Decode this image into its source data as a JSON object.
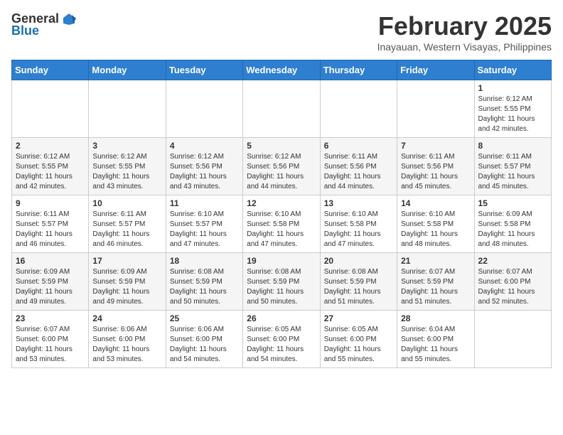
{
  "header": {
    "logo_general": "General",
    "logo_blue": "Blue",
    "month_year": "February 2025",
    "location": "Inayauan, Western Visayas, Philippines"
  },
  "days_of_week": [
    "Sunday",
    "Monday",
    "Tuesday",
    "Wednesday",
    "Thursday",
    "Friday",
    "Saturday"
  ],
  "weeks": [
    [
      {
        "day": "",
        "info": ""
      },
      {
        "day": "",
        "info": ""
      },
      {
        "day": "",
        "info": ""
      },
      {
        "day": "",
        "info": ""
      },
      {
        "day": "",
        "info": ""
      },
      {
        "day": "",
        "info": ""
      },
      {
        "day": "1",
        "info": "Sunrise: 6:12 AM\nSunset: 5:55 PM\nDaylight: 11 hours and 42 minutes."
      }
    ],
    [
      {
        "day": "2",
        "info": "Sunrise: 6:12 AM\nSunset: 5:55 PM\nDaylight: 11 hours and 42 minutes."
      },
      {
        "day": "3",
        "info": "Sunrise: 6:12 AM\nSunset: 5:55 PM\nDaylight: 11 hours and 43 minutes."
      },
      {
        "day": "4",
        "info": "Sunrise: 6:12 AM\nSunset: 5:56 PM\nDaylight: 11 hours and 43 minutes."
      },
      {
        "day": "5",
        "info": "Sunrise: 6:12 AM\nSunset: 5:56 PM\nDaylight: 11 hours and 44 minutes."
      },
      {
        "day": "6",
        "info": "Sunrise: 6:11 AM\nSunset: 5:56 PM\nDaylight: 11 hours and 44 minutes."
      },
      {
        "day": "7",
        "info": "Sunrise: 6:11 AM\nSunset: 5:56 PM\nDaylight: 11 hours and 45 minutes."
      },
      {
        "day": "8",
        "info": "Sunrise: 6:11 AM\nSunset: 5:57 PM\nDaylight: 11 hours and 45 minutes."
      }
    ],
    [
      {
        "day": "9",
        "info": "Sunrise: 6:11 AM\nSunset: 5:57 PM\nDaylight: 11 hours and 46 minutes."
      },
      {
        "day": "10",
        "info": "Sunrise: 6:11 AM\nSunset: 5:57 PM\nDaylight: 11 hours and 46 minutes."
      },
      {
        "day": "11",
        "info": "Sunrise: 6:10 AM\nSunset: 5:57 PM\nDaylight: 11 hours and 47 minutes."
      },
      {
        "day": "12",
        "info": "Sunrise: 6:10 AM\nSunset: 5:58 PM\nDaylight: 11 hours and 47 minutes."
      },
      {
        "day": "13",
        "info": "Sunrise: 6:10 AM\nSunset: 5:58 PM\nDaylight: 11 hours and 47 minutes."
      },
      {
        "day": "14",
        "info": "Sunrise: 6:10 AM\nSunset: 5:58 PM\nDaylight: 11 hours and 48 minutes."
      },
      {
        "day": "15",
        "info": "Sunrise: 6:09 AM\nSunset: 5:58 PM\nDaylight: 11 hours and 48 minutes."
      }
    ],
    [
      {
        "day": "16",
        "info": "Sunrise: 6:09 AM\nSunset: 5:59 PM\nDaylight: 11 hours and 49 minutes."
      },
      {
        "day": "17",
        "info": "Sunrise: 6:09 AM\nSunset: 5:59 PM\nDaylight: 11 hours and 49 minutes."
      },
      {
        "day": "18",
        "info": "Sunrise: 6:08 AM\nSunset: 5:59 PM\nDaylight: 11 hours and 50 minutes."
      },
      {
        "day": "19",
        "info": "Sunrise: 6:08 AM\nSunset: 5:59 PM\nDaylight: 11 hours and 50 minutes."
      },
      {
        "day": "20",
        "info": "Sunrise: 6:08 AM\nSunset: 5:59 PM\nDaylight: 11 hours and 51 minutes."
      },
      {
        "day": "21",
        "info": "Sunrise: 6:07 AM\nSunset: 5:59 PM\nDaylight: 11 hours and 51 minutes."
      },
      {
        "day": "22",
        "info": "Sunrise: 6:07 AM\nSunset: 6:00 PM\nDaylight: 11 hours and 52 minutes."
      }
    ],
    [
      {
        "day": "23",
        "info": "Sunrise: 6:07 AM\nSunset: 6:00 PM\nDaylight: 11 hours and 53 minutes."
      },
      {
        "day": "24",
        "info": "Sunrise: 6:06 AM\nSunset: 6:00 PM\nDaylight: 11 hours and 53 minutes."
      },
      {
        "day": "25",
        "info": "Sunrise: 6:06 AM\nSunset: 6:00 PM\nDaylight: 11 hours and 54 minutes."
      },
      {
        "day": "26",
        "info": "Sunrise: 6:05 AM\nSunset: 6:00 PM\nDaylight: 11 hours and 54 minutes."
      },
      {
        "day": "27",
        "info": "Sunrise: 6:05 AM\nSunset: 6:00 PM\nDaylight: 11 hours and 55 minutes."
      },
      {
        "day": "28",
        "info": "Sunrise: 6:04 AM\nSunset: 6:00 PM\nDaylight: 11 hours and 55 minutes."
      },
      {
        "day": "",
        "info": ""
      }
    ]
  ]
}
